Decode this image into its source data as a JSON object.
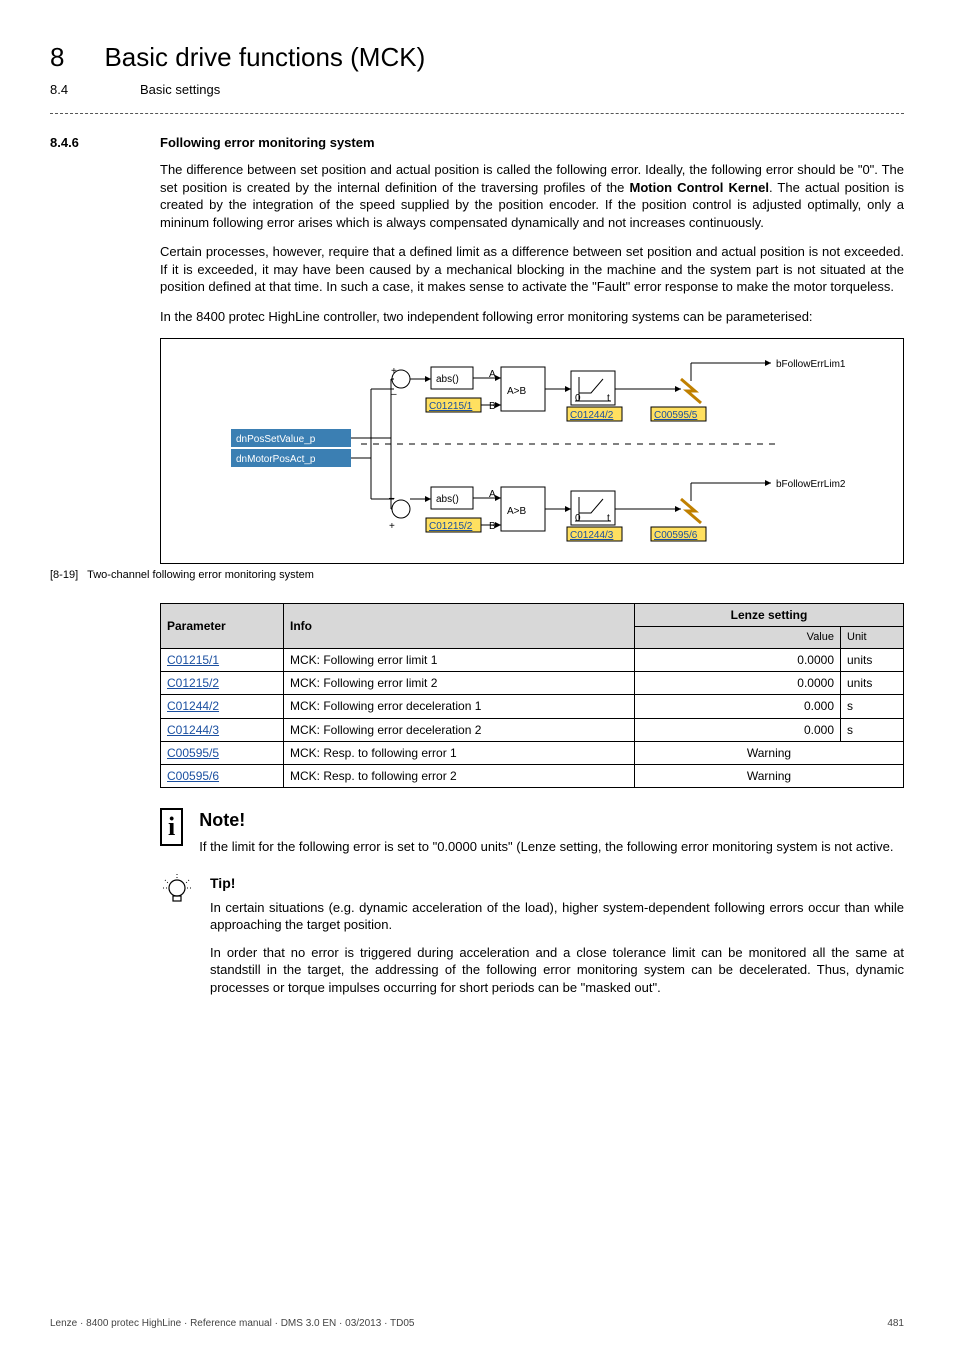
{
  "chapter": {
    "num": "8",
    "title": "Basic drive functions (MCK)"
  },
  "subsection": {
    "num": "8.4",
    "title": "Basic settings"
  },
  "section": {
    "num": "8.4.6",
    "title": "Following error monitoring system"
  },
  "paras": {
    "p1a": "The difference between set position and actual position is called the following error. Ideally, the following error should be \"0\". The set position is created by the internal definition of the traversing profiles of the ",
    "p1b": "Motion Control Kernel",
    "p1c": ". The actual position is created by the integration of the speed supplied by the position encoder. If the position control is adjusted optimally, only a mininum following error arises which is always compensated dynamically and not increases continuously.",
    "p2": "Certain processes, however, require that a defined limit as a difference between set position and actual position is not exceeded. If it is exceeded, it may have been caused by a mechanical blocking in the machine and the system part is not situated at the position defined at that time. In such a case, it makes sense to activate the \"Fault\" error response to make the motor torqueless.",
    "p3": "In the 8400 protec HighLine controller, two independent following error monitoring systems can be parameterised:"
  },
  "diagram": {
    "port1": "dnPosSetValue_p",
    "port2": "dnMotorPosAct_p",
    "abs": "abs()",
    "comp": "A>B",
    "a": "A",
    "b": "B",
    "plus": "+",
    "minus": "–",
    "c1": "C01215/1",
    "c2": "C01244/2",
    "c3": "C00595/5",
    "c4": "C01215/2",
    "c5": "C01244/3",
    "c6": "C00595/6",
    "out1": "bFollowErrLim1",
    "out2": "bFollowErrLim2",
    "t0": "0",
    "tt": "t"
  },
  "figcap": {
    "num": "[8-19]",
    "text": "Two-channel following error monitoring system"
  },
  "table": {
    "headers": {
      "param": "Parameter",
      "info": "Info",
      "lenze": "Lenze setting",
      "value": "Value",
      "unit": "Unit"
    },
    "rows": [
      {
        "param": "C01215/1",
        "info": "MCK: Following error limit 1",
        "value": "0.0000",
        "unit": "units",
        "warning": ""
      },
      {
        "param": "C01215/2",
        "info": "MCK: Following error limit 2",
        "value": "0.0000",
        "unit": "units",
        "warning": ""
      },
      {
        "param": "C01244/2",
        "info": "MCK: Following error deceleration 1",
        "value": "0.000",
        "unit": "s",
        "warning": ""
      },
      {
        "param": "C01244/3",
        "info": "MCK: Following error deceleration 2",
        "value": "0.000",
        "unit": "s",
        "warning": ""
      },
      {
        "param": "C00595/5",
        "info": "MCK: Resp. to following error 1",
        "value": "",
        "unit": "",
        "warning": "Warning"
      },
      {
        "param": "C00595/6",
        "info": "MCK: Resp. to following error 2",
        "value": "",
        "unit": "",
        "warning": "Warning"
      }
    ]
  },
  "note": {
    "title": "Note!",
    "text": "If the limit for the following error is set to \"0.0000 units\" (Lenze setting, the following error monitoring system is not active."
  },
  "tip": {
    "title": "Tip!",
    "p1": "In certain situations (e.g. dynamic acceleration of the load), higher system-dependent following errors occur than while approaching the target position.",
    "p2": "In order that no error is triggered during acceleration and a close tolerance limit can be monitored all the same at standstill in the target, the addressing of the following error monitoring system can be decelerated. Thus, dynamic processes or torque impulses occurring for short periods can be \"masked out\"."
  },
  "footer": {
    "left": "Lenze · 8400 protec HighLine · Reference manual · DMS 3.0 EN · 03/2013 · TD05",
    "right": "481"
  }
}
